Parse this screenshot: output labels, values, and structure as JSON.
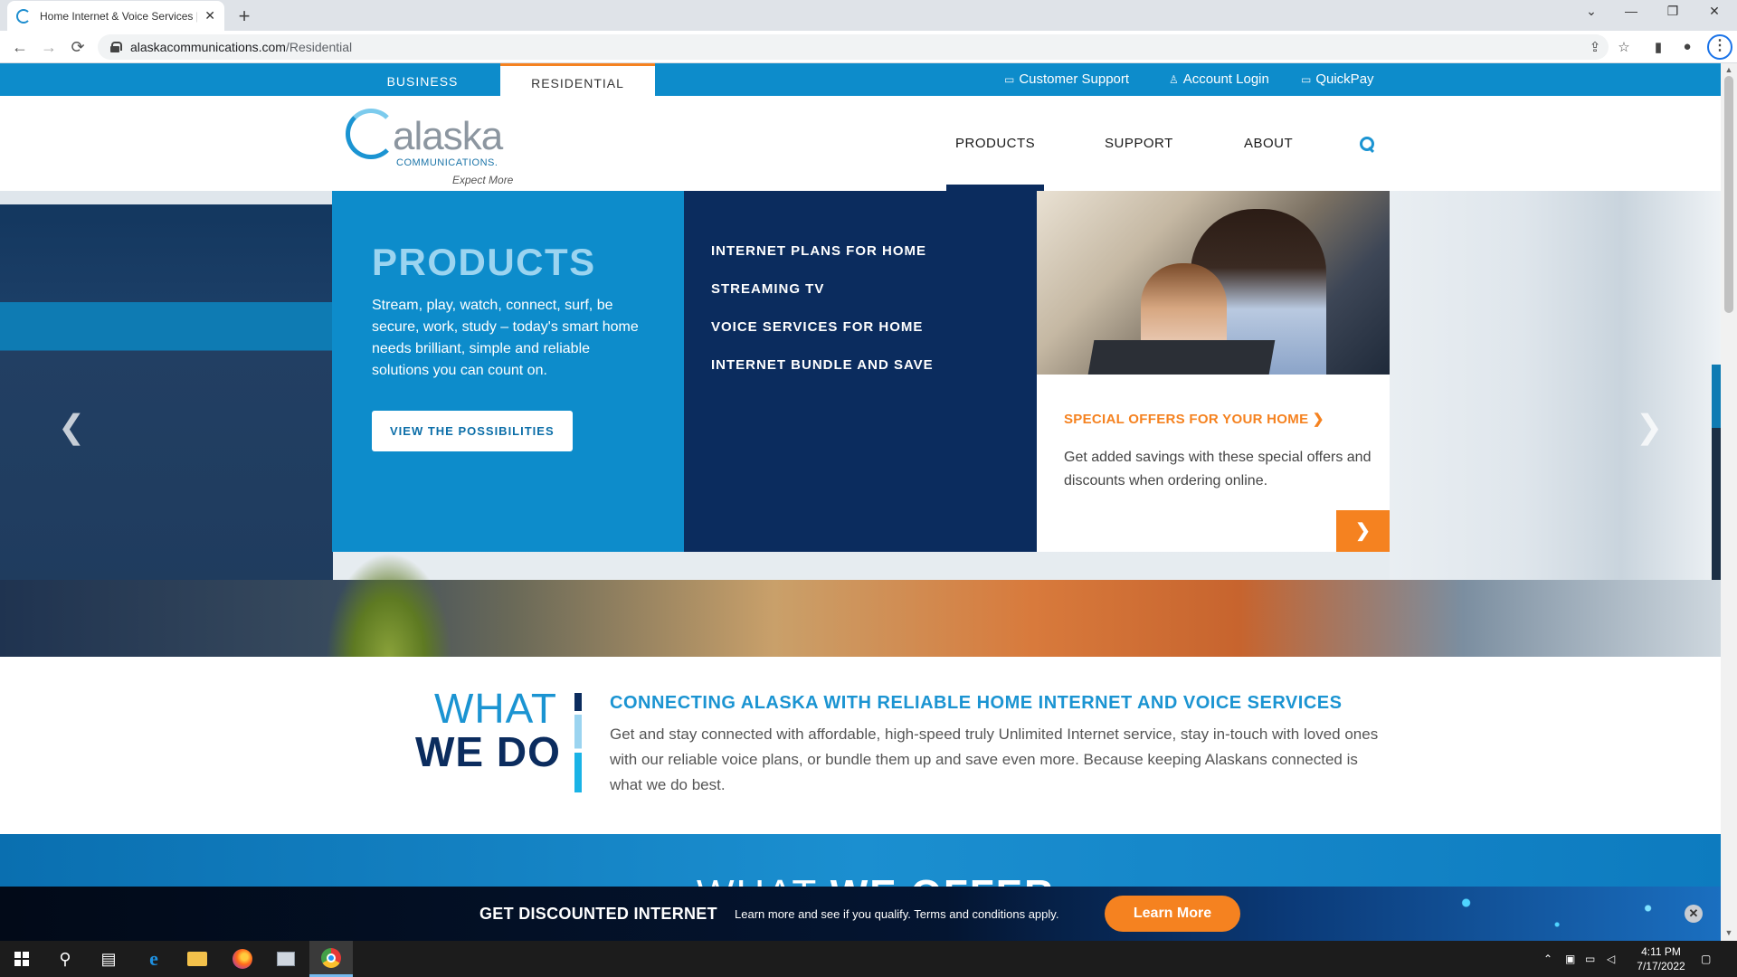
{
  "browser": {
    "tab_title": "Home Internet & Voice Services |",
    "tab_close": "✕",
    "new_tab": "+",
    "url_domain": "alaskacommunications.com",
    "url_path": "/Residential",
    "back": "←",
    "forward": "→",
    "reload": "⟳",
    "win_min": "—",
    "win_restore": "❐",
    "win_close": "✕",
    "win_chevron": "⌄"
  },
  "topnav": {
    "business": "BUSINESS",
    "residential": "RESIDENTIAL",
    "customer_support": "Customer Support",
    "account_login": "Account Login",
    "quickpay": "QuickPay"
  },
  "logo": {
    "word": "alaska",
    "sub": "COMMUNICATIONS.",
    "tagline": "Expect More"
  },
  "mainnav": {
    "products": "PRODUCTS",
    "support": "SUPPORT",
    "about": "ABOUT"
  },
  "mega": {
    "title": "PRODUCTS",
    "description": "Stream, play, watch, connect, surf, be secure, work, study – today's smart home needs brilliant, simple and reliable solutions you can count on.",
    "cta": "VIEW THE POSSIBILITIES",
    "links": [
      "INTERNET PLANS FOR HOME",
      "STREAMING TV",
      "VOICE SERVICES FOR HOME",
      "INTERNET BUNDLE AND SAVE"
    ],
    "promo_heading": "SPECIAL OFFERS FOR YOUR HOME",
    "promo_chevron": "❯",
    "promo_text": "Get added savings with these special offers and discounts when ordering online.",
    "promo_arrow": "❯"
  },
  "carousel": {
    "prev": "❮",
    "next": "❯"
  },
  "whatwedo": {
    "what": "WHAT",
    "wedo": "WE DO",
    "heading": "CONNECTING ALASKA WITH RELIABLE HOME INTERNET AND VOICE SERVICES",
    "body": "Get and stay connected with affordable, high-speed truly Unlimited Internet service, stay in-touch with loved ones with our reliable voice plans, or bundle them up and save even more. Because keeping Alaskans connected is what we do best."
  },
  "offer": {
    "what": "WHAT",
    "we_offer": "WE OFFER"
  },
  "banner": {
    "title": "GET DISCOUNTED INTERNET",
    "text": "Learn more and see if you qualify. Terms and conditions apply.",
    "button": "Learn More",
    "close": "✕"
  },
  "taskbar": {
    "time": "4:11 PM",
    "date": "7/17/2022"
  },
  "colors": {
    "brand_blue": "#0d8ccb",
    "navy": "#0b2c5e",
    "orange": "#f58220"
  }
}
